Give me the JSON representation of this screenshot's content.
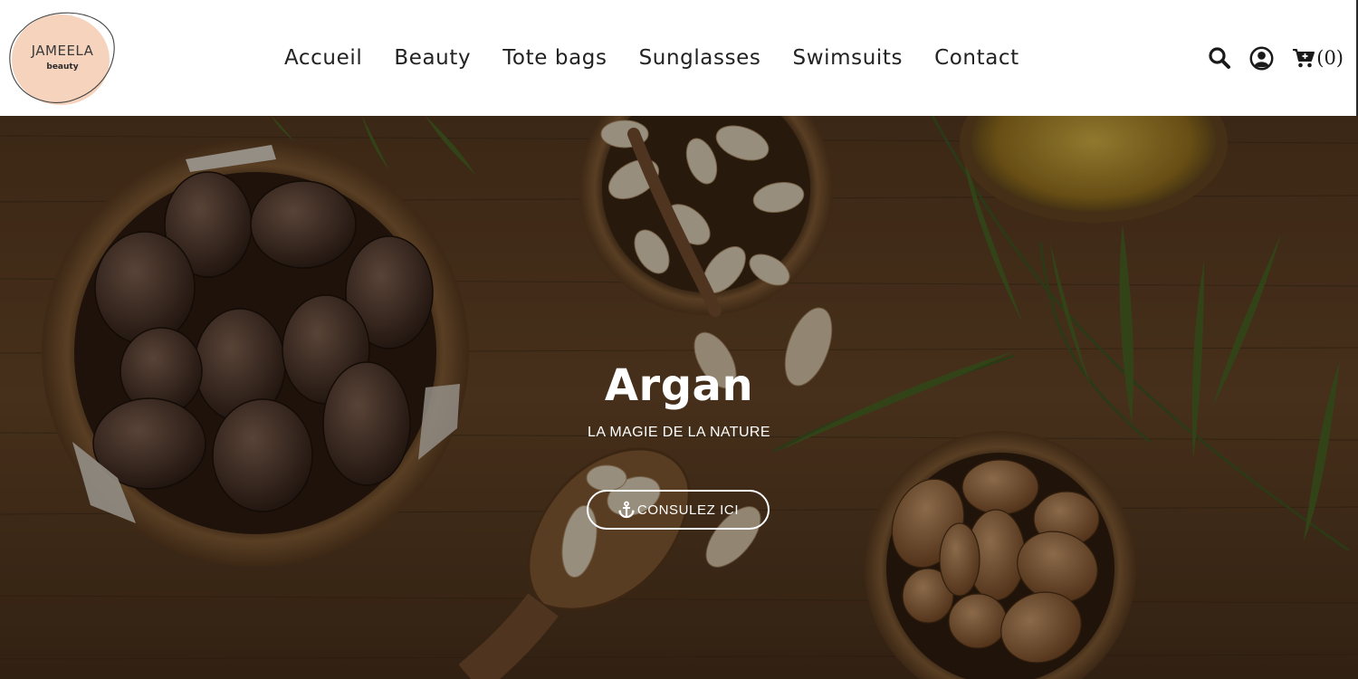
{
  "brand": {
    "name": "JAMEELA",
    "tagline": "beauty",
    "logo_color": "#f6d3bd"
  },
  "nav": {
    "items": [
      {
        "label": "Accueil"
      },
      {
        "label": "Beauty"
      },
      {
        "label": "Tote bags"
      },
      {
        "label": "Sunglasses"
      },
      {
        "label": "Swimsuits"
      },
      {
        "label": "Contact"
      }
    ]
  },
  "header_icons": {
    "search_icon": "search-icon",
    "account_icon": "user-circle-icon",
    "cart_icon": "cart-plus-icon",
    "cart_count": "(0)"
  },
  "hero": {
    "title": "Argan",
    "subtitle": "LA MAGIE DE LA NATURE",
    "button_label": "CONSULEZ ICI",
    "button_icon": "anchor-icon",
    "overlay_color": "#0a0602"
  }
}
